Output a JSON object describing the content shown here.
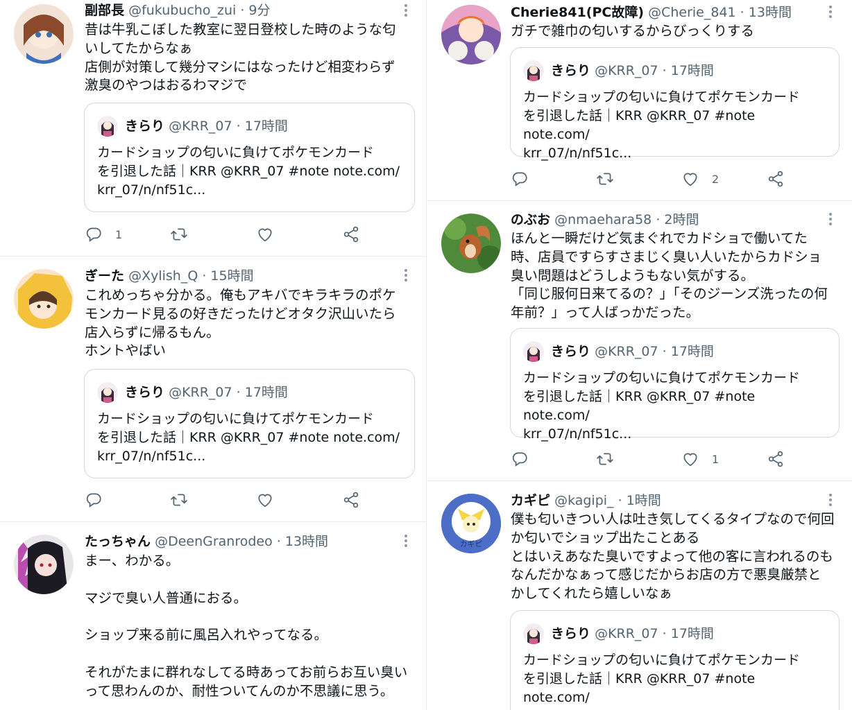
{
  "quote": {
    "name": "きらり",
    "handle": "@KRR_07",
    "dot": "·",
    "time": "17時間",
    "body": "カードショップの匂いに負けてポケモンカード\nを引退した話｜KRR @KRR_07 #note note.com/\nkrr_07/n/nf51c..."
  },
  "left": {
    "t1": {
      "name": "副部長",
      "handle": "@fukubucho_zui",
      "dot": "·",
      "time": "9分",
      "body": "昔は牛乳こぼした教室に翌日登校した時のような匂\nいしてたからなぁ\n店側が対策して幾分マシにはなったけど相変わらず\n激臭のやつはおるわマジで",
      "reply_count": "1",
      "retweet_count": "",
      "like_count": ""
    },
    "t2": {
      "name": "ぎーた",
      "handle": "@Xylish_Q",
      "dot": "·",
      "time": "15時間",
      "body": "これめっちゃ分かる。俺もアキバでキラキラのポケ\nモンカード見るの好きだったけどオタク沢山いたら\n店入らずに帰るもん。\nホントやばい",
      "reply_count": "",
      "retweet_count": "",
      "like_count": ""
    },
    "t3": {
      "name": "たっちゃん",
      "handle": "@DeenGranrodeo",
      "dot": "·",
      "time": "13時間",
      "body": "まー、わかる。\n\nマジで臭い人普通におる。\n\nショップ来る前に風呂入れやってなる。\n\nそれがたまに群れなしてる時あってお前らお互い臭い\nって思わんのか、耐性ついてんのか不思議に思う。"
    }
  },
  "right": {
    "t1": {
      "name": "Cherie841(PC故障)",
      "handle": "@Cherie_841",
      "dot": "·",
      "time": "13時間",
      "body": "ガチで雑巾の匂いするからびっくりする",
      "reply_count": "",
      "retweet_count": "",
      "like_count": "2"
    },
    "t2": {
      "name": "のぶお",
      "handle": "@nmaehara58",
      "dot": "·",
      "time": "2時間",
      "body": "ほんと一瞬だけど気まぐれでカドショで働いてた\n時、店員ですらすさまじく臭い人いたからカドショ\n臭い問題はどうしようもない気がする。\n「同じ服何日来てるの？」「そのジーンズ洗ったの何\n年前？」って人ばっかだった。",
      "reply_count": "",
      "retweet_count": "",
      "like_count": "1"
    },
    "t3": {
      "name": "カギピ",
      "handle": "@kagipi_",
      "dot": "·",
      "time": "1時間",
      "body": "僕も匂いきつい人は吐き気してくるタイプなので何回\nか匂いでショップ出たことある\nとはいえあなた臭いですよって他の客に言われるのも\nなんだかなぁって感じだからお店の方で悪臭厳禁と\nかしてくれたら嬉しいなぁ",
      "avatar_text": "カギピ"
    }
  },
  "icons": {
    "reply": "reply-icon",
    "retweet": "retweet-icon",
    "like": "heart-icon",
    "share": "share-icon",
    "more": "more-vertical-icon"
  },
  "colors": {
    "secondary_text": "#536471",
    "border": "#cfd9de",
    "divider": "#e6ecf0"
  }
}
